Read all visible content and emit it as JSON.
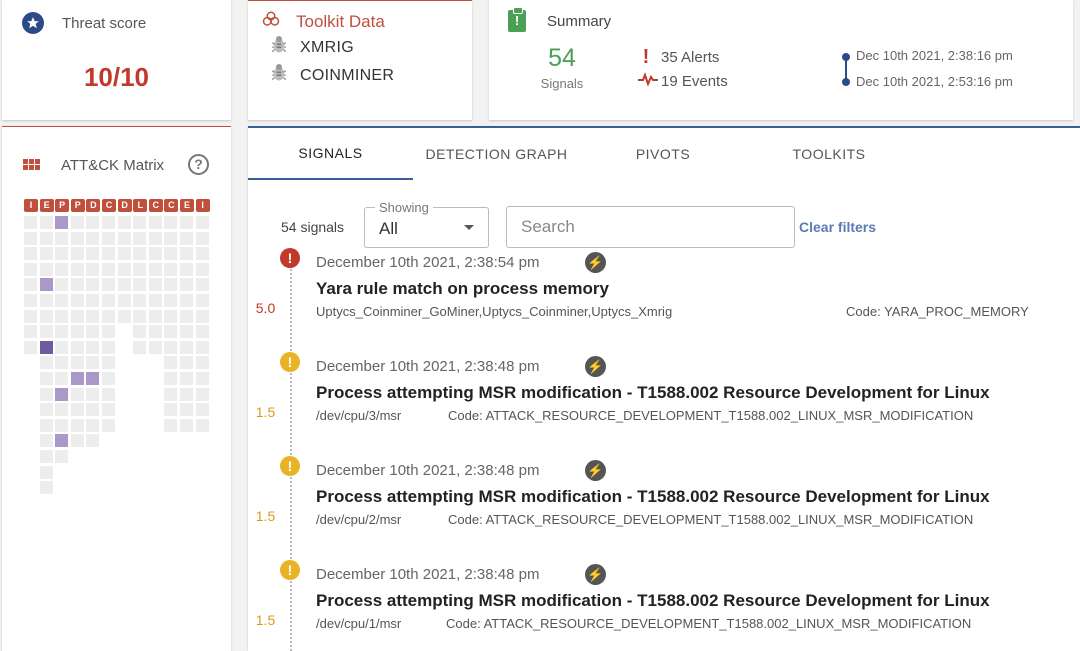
{
  "threat": {
    "title": "Threat score",
    "score": "10/10"
  },
  "toolkit": {
    "title": "Toolkit Data",
    "items": [
      "XMRIG",
      "COINMINER"
    ]
  },
  "summary": {
    "title": "Summary",
    "signals_count": "54",
    "signals_label": "Signals",
    "alerts": "35 Alerts",
    "events": "19 Events",
    "start": "Dec 10th 2021, 2:38:16 pm",
    "end": "Dec 10th 2021, 2:53:16 pm"
  },
  "attack": {
    "title": "ATT&CK Matrix",
    "help": "?",
    "tactics": [
      "I",
      "E",
      "P",
      "P",
      "D",
      "C",
      "D",
      "L",
      "C",
      "C",
      "E",
      "I"
    ]
  },
  "tabs": [
    "SIGNALS",
    "DETECTION GRAPH",
    "PIVOTS",
    "TOOLKITS"
  ],
  "filters": {
    "count_label": "54 signals",
    "showing_label": "Showing",
    "showing_value": "All",
    "search_placeholder": "Search",
    "clear_label": "Clear filters"
  },
  "signals": [
    {
      "severity": "high",
      "score": "5.0",
      "date": "December 10th 2021, 2:38:54 pm",
      "title": "Yara rule match on process memory",
      "detail": "Uptycs_Coinminer_GoMiner,Uptycs_Coinminer,Uptycs_Xmrig",
      "code": "Code: YARA_PROC_MEMORY"
    },
    {
      "severity": "medium",
      "score": "1.5",
      "date": "December 10th 2021, 2:38:48 pm",
      "title": "Process attempting MSR modification - T1588.002 Resource Development for Linux",
      "detail": "/dev/cpu/3/msr",
      "code": "Code: ATTACK_RESOURCE_DEVELOPMENT_T1588.002_LINUX_MSR_MODIFICATION"
    },
    {
      "severity": "medium",
      "score": "1.5",
      "date": "December 10th 2021, 2:38:48 pm",
      "title": "Process attempting MSR modification - T1588.002 Resource Development for Linux",
      "detail": "/dev/cpu/2/msr",
      "code": "Code: ATTACK_RESOURCE_DEVELOPMENT_T1588.002_LINUX_MSR_MODIFICATION"
    },
    {
      "severity": "medium",
      "score": "1.5",
      "date": "December 10th 2021, 2:38:48 pm",
      "title": "Process attempting MSR modification - T1588.002 Resource Development for Linux",
      "detail": "/dev/cpu/1/msr",
      "code": "Code: ATTACK_RESOURCE_DEVELOPMENT_T1588.002_LINUX_MSR_MODIFICATION"
    }
  ]
}
